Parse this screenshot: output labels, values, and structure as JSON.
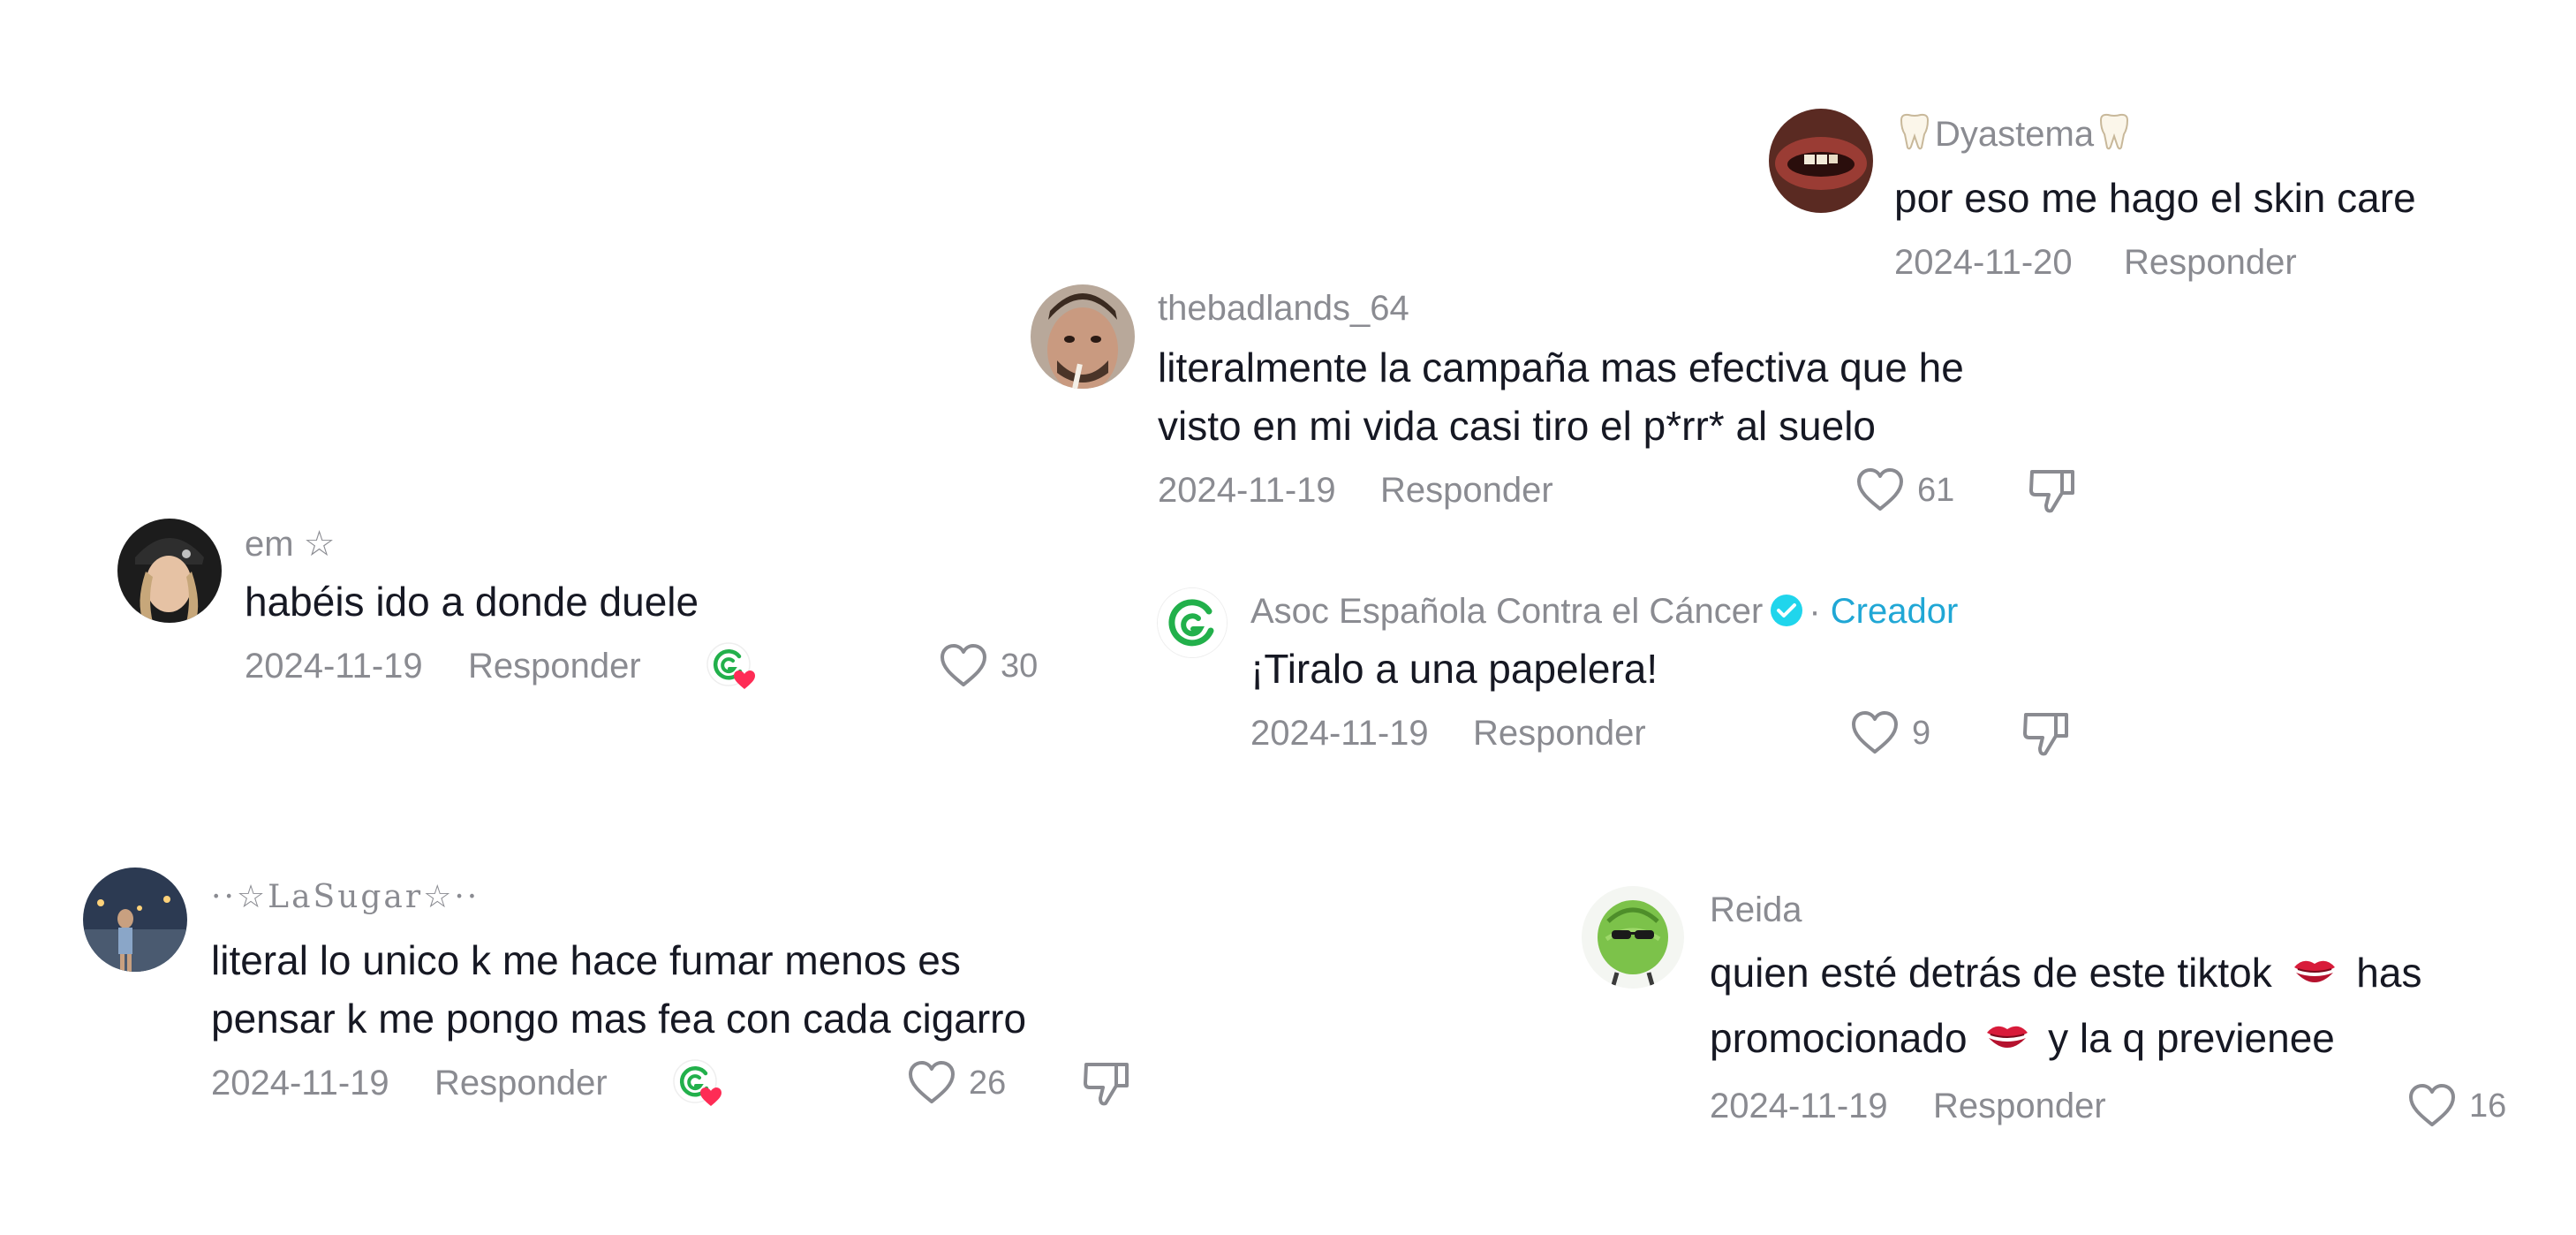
{
  "comments": [
    {
      "username": "Dyastema",
      "text": "por eso me hago el skin care",
      "date": "2024-11-20",
      "reply_label": "Responder"
    },
    {
      "username": "thebadlands_64",
      "text_lines": [
        "literalmente la campaña mas efectiva que he",
        "visto en mi vida casi tiro el p*rr* al suelo"
      ],
      "date": "2024-11-19",
      "reply_label": "Responder",
      "likes": "61"
    },
    {
      "username": "Asoc Española Contra el Cáncer",
      "separator": "·",
      "creator_label": "Creador",
      "text": "¡Tiralo a una papelera!",
      "date": "2024-11-19",
      "reply_label": "Responder",
      "likes": "9"
    },
    {
      "username": "em ☆",
      "text": "habéis ido a donde duele",
      "date": "2024-11-19",
      "reply_label": "Responder",
      "likes": "30"
    },
    {
      "username": "··☆LaSugar☆··",
      "text_lines": [
        "literal lo unico k me hace fumar menos es",
        "pensar k me pongo mas fea con cada cigarro"
      ],
      "date": "2024-11-19",
      "reply_label": "Responder",
      "likes": "26"
    },
    {
      "username": "Reida",
      "text_line1": "quien esté detrás de este tiktok",
      "text_line1_end": "has",
      "text_line2_start": "promocionado",
      "text_line2_end": "y la q previenee",
      "date": "2024-11-19",
      "reply_label": "Responder",
      "likes": "16"
    }
  ],
  "colors": {
    "text": "#161823",
    "muted": "#8a8b91",
    "creator": "#20a7d5",
    "heart_badge": "#fe2c55",
    "brand_green": "#22b04b"
  },
  "icons": [
    "heart-outline-icon",
    "thumbs-down-icon",
    "verified-badge-icon",
    "creator-liked-icon",
    "tooth-emoji",
    "kiss-emoji"
  ]
}
